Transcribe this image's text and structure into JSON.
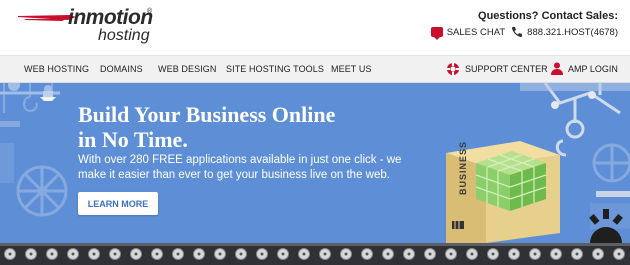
{
  "brand": {
    "name": "inmotion",
    "sub": "hosting",
    "reg": "®"
  },
  "contact": {
    "title": "Questions? Contact Sales:",
    "chat_label": "SALES CHAT",
    "phone": "888.321.HOST(4678)"
  },
  "nav": {
    "items": [
      "WEB HOSTING",
      "DOMAINS",
      "WEB DESIGN",
      "SITE HOSTING TOOLS",
      "MEET US"
    ],
    "support": "SUPPORT CENTER",
    "login": "AMP LOGIN"
  },
  "hero": {
    "title_line1": "Build Your Business Online",
    "title_line2": "in No Time.",
    "text": "With over 280 FREE applications available in just one click - we make it easier than ever to get your business live on the web.",
    "cta": "LEARN MORE",
    "box_label": "BUSINESS"
  },
  "colors": {
    "hero_bg": "#5e8fd6",
    "brand_red": "#c8102e",
    "box": "#e7cf8c",
    "cube": "#8ccf6a"
  },
  "icons": [
    "chat-icon",
    "phone-icon",
    "support-icon",
    "user-icon",
    "swoosh-icon"
  ]
}
